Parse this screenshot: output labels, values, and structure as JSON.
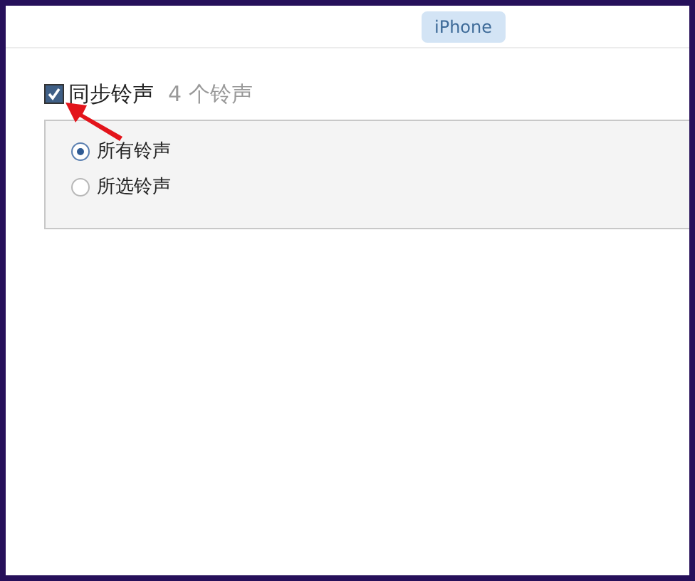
{
  "device_badge": "iPhone",
  "sync": {
    "label": "同步铃声",
    "count": "4 个铃声",
    "checked": true
  },
  "options": [
    {
      "label": "所有铃声",
      "selected": true
    },
    {
      "label": "所选铃声",
      "selected": false
    }
  ]
}
